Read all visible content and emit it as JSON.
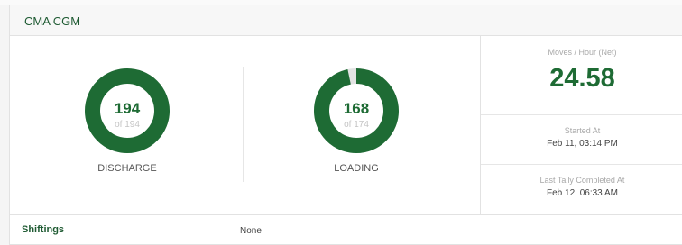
{
  "header": {
    "title": "CMA CGM"
  },
  "discharge": {
    "value": "194",
    "total_text": "of 194",
    "label": "DISCHARGE",
    "progress": 1.0
  },
  "loading": {
    "value": "168",
    "total_text": "of 174",
    "label": "LOADING",
    "progress": 0.9655
  },
  "stats": {
    "moves_caption": "Moves / Hour (Net)",
    "moves_value": "24.58",
    "started_caption": "Started At",
    "started_value": "Feb 11, 03:14 PM",
    "tally_caption": "Last Tally Completed At",
    "tally_value": "Feb 12, 06:33 AM"
  },
  "shiftings": {
    "label": "Shiftings",
    "value": "None"
  },
  "colors": {
    "accent": "#1e6b34",
    "track": "#e3e3e3"
  }
}
